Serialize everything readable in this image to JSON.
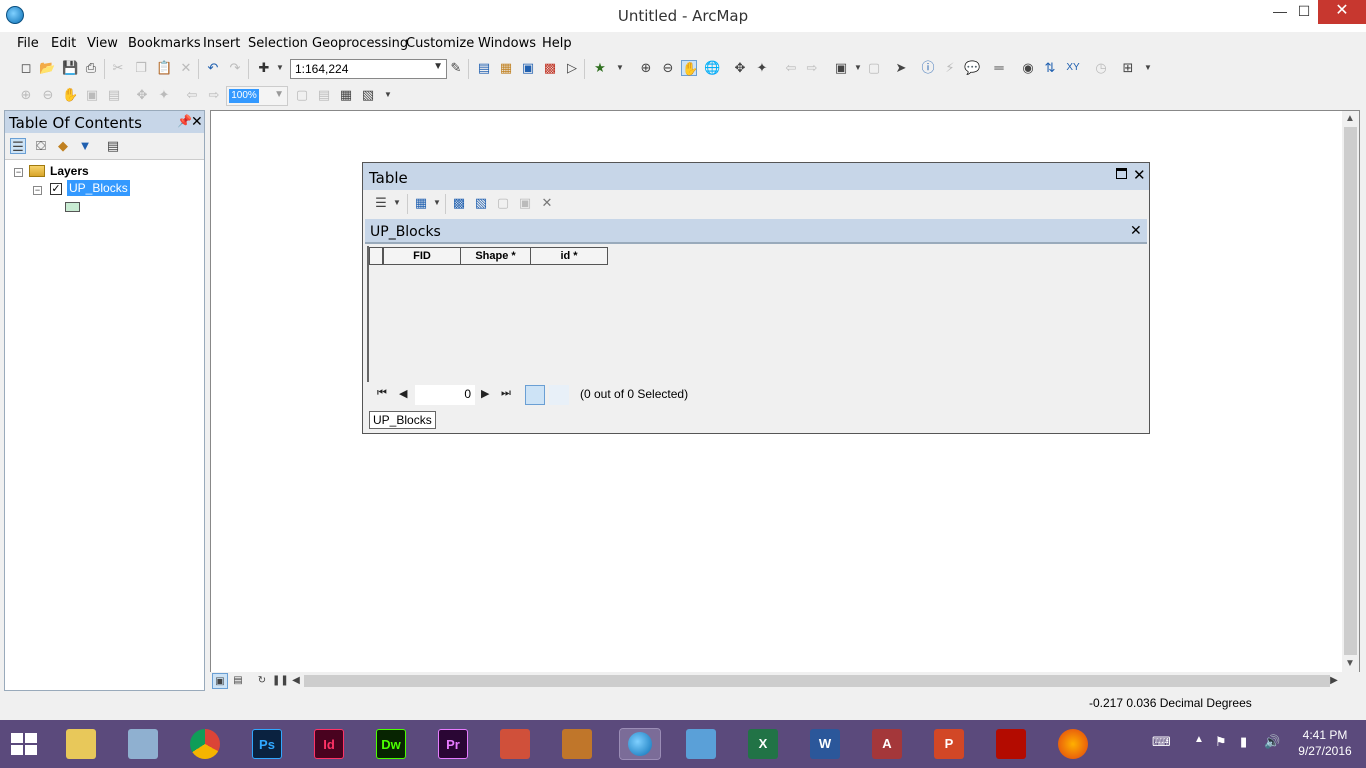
{
  "window": {
    "title": "Untitled - ArcMap",
    "minimize": "—",
    "maximize": "☐",
    "close": "✕"
  },
  "menu": [
    "File",
    "Edit",
    "View",
    "Bookmarks",
    "Insert",
    "Selection",
    "Geoprocessing",
    "Customize",
    "Windows",
    "Help"
  ],
  "toolbar": {
    "scale_value": "1:164,224",
    "zoom_value": "100%"
  },
  "toc": {
    "title": "Table Of Contents",
    "root_label": "Layers",
    "layer_label": "UP_Blocks",
    "layer_checked": true
  },
  "table_window": {
    "title": "Table",
    "subtable_title": "UP_Blocks",
    "columns": [
      "FID",
      "Shape *",
      "id *"
    ],
    "record_value": "0",
    "selected_status": "(0 out of 0 Selected)",
    "tab_label": "UP_Blocks"
  },
  "status": {
    "coordinates": "-0.217  0.036 Decimal Degrees"
  },
  "taskbar": {
    "apps": [
      "file-explorer",
      "calculator",
      "chrome",
      "photoshop",
      "indesign",
      "dreamweaver",
      "premiere",
      "ccleaner",
      "movie-maker",
      "arcmap",
      "remote-desktop",
      "excel",
      "word",
      "access",
      "powerpoint",
      "acrobat",
      "firefox"
    ],
    "ps_label": "Ps",
    "id_label": "Id",
    "dw_label": "Dw",
    "pr_label": "Pr",
    "time": "4:41 PM",
    "date": "9/27/2016"
  },
  "colors": {
    "panel_header": "#c7d6e8",
    "selection_blue": "#3399ff",
    "taskbar": "#5b4a7c"
  }
}
